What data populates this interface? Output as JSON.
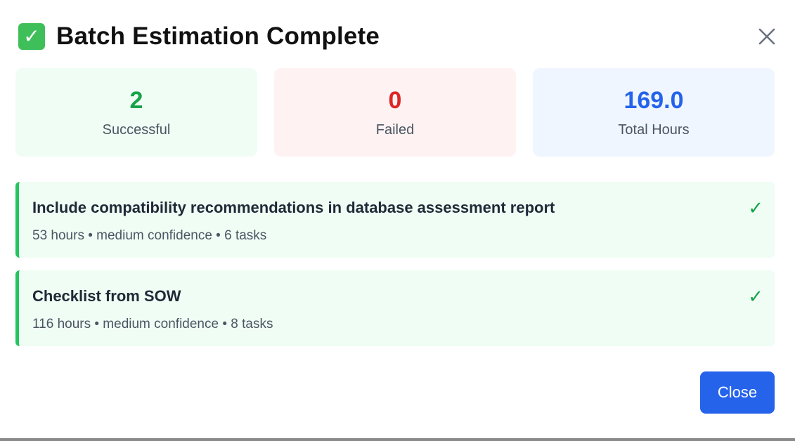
{
  "modal": {
    "title": "Batch Estimation Complete",
    "title_icon": "check-mark-button-icon",
    "close_icon": "close-icon"
  },
  "stats": [
    {
      "value": "2",
      "label": "Successful",
      "color": "#16a34a"
    },
    {
      "value": "0",
      "label": "Failed",
      "color": "#dc2626"
    },
    {
      "value": "169.0",
      "label": "Total Hours",
      "color": "#2563eb"
    }
  ],
  "results": [
    {
      "title": "Include compatibility recommendations in database assessment report",
      "meta": "53 hours • medium confidence • 6 tasks",
      "status_icon": "check-icon"
    },
    {
      "title": "Checklist from SOW",
      "meta": "116 hours • medium confidence • 8 tasks",
      "status_icon": "check-icon"
    }
  ],
  "footer": {
    "close_label": "Close"
  },
  "colors": {
    "primary": "#2563eb",
    "success": "#22c55e"
  }
}
